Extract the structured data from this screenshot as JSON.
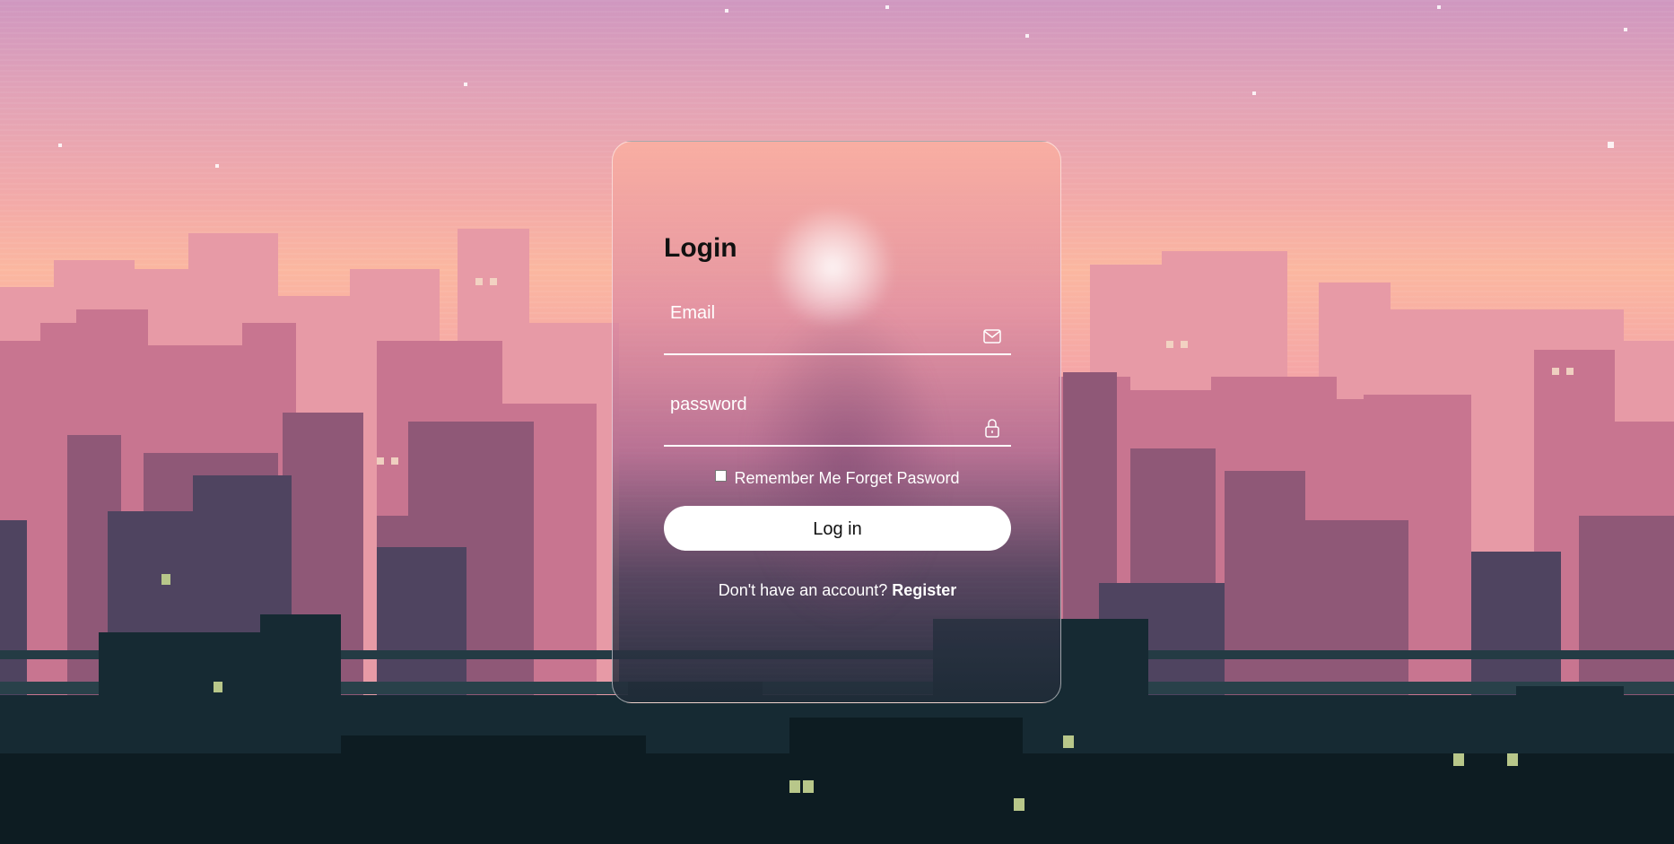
{
  "login": {
    "title": "Login",
    "email_placeholder": "Email",
    "password_placeholder": "password",
    "remember_label": "Remember Me",
    "forgot_label": "Forget Pasword",
    "submit_label": "Log in",
    "register_prompt": "Don't have an account?",
    "register_label": "Register"
  },
  "icons": {
    "email": "mail-icon",
    "password": "lock-icon"
  },
  "colors": {
    "accent": "#ffffff",
    "title_text": "#111111",
    "button_bg": "#ffffff"
  }
}
